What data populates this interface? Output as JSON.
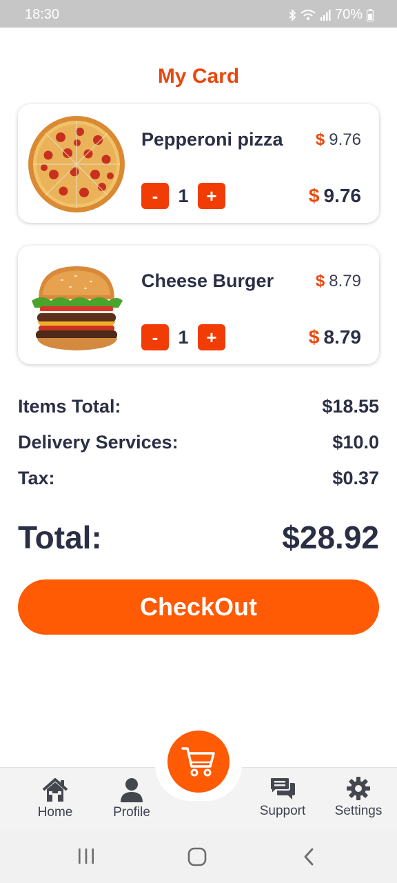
{
  "status_bar": {
    "time": "18:30",
    "battery": "70%"
  },
  "page": {
    "title": "My Card"
  },
  "cart": {
    "items": [
      {
        "name": "Pepperoni pizza",
        "unit_price": "9.76",
        "quantity": "1",
        "line_total": "9.76",
        "currency": "$",
        "image": "pepperoni-pizza-image"
      },
      {
        "name": "Cheese Burger",
        "unit_price": "8.79",
        "quantity": "1",
        "line_total": "8.79",
        "currency": "$",
        "image": "cheese-burger-image"
      }
    ],
    "minus_label": "-",
    "plus_label": "+"
  },
  "summary": {
    "items_total_label": "Items Total:",
    "items_total": "$18.55",
    "delivery_label": "Delivery Services:",
    "delivery": "$10.0",
    "tax_label": "Tax:",
    "tax": "$0.37",
    "total_label": "Total:",
    "total": "$28.92"
  },
  "checkout": {
    "label": "CheckOut"
  },
  "bottom_nav": {
    "items": [
      {
        "label": "Home",
        "icon": "home-icon"
      },
      {
        "label": "Profile",
        "icon": "person-icon"
      },
      {
        "label": "Support",
        "icon": "chat-icon"
      },
      {
        "label": "Settings",
        "icon": "gear-icon"
      }
    ],
    "center_icon": "cart-icon"
  },
  "colors": {
    "accent": "#ff5a04",
    "title": "#e8480e",
    "text": "#2b2f45"
  }
}
